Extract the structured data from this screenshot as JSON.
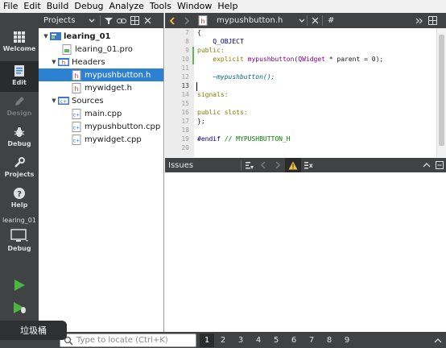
{
  "menu": [
    "File",
    "Edit",
    "Build",
    "Debug",
    "Analyze",
    "Tools",
    "Window",
    "Help"
  ],
  "modes": [
    {
      "label": "Welcome",
      "icon": "grid-icon"
    },
    {
      "label": "Edit",
      "icon": "document-icon"
    },
    {
      "label": "Design",
      "icon": "pencil-icon"
    },
    {
      "label": "Debug",
      "icon": "bug-icon"
    },
    {
      "label": "Projects",
      "icon": "wrench-icon"
    },
    {
      "label": "Help",
      "icon": "help-icon"
    }
  ],
  "kit": {
    "project": "learing_01",
    "mode": "Debug"
  },
  "projects_pane": {
    "title": "Projects",
    "tree": [
      {
        "label": "learing_01",
        "level": 0,
        "icon": "project-icon",
        "expanded": true
      },
      {
        "label": "learing_01.pro",
        "level": 1,
        "icon": "pro-file-icon"
      },
      {
        "label": "Headers",
        "level": 1,
        "icon": "folder-h-icon",
        "expanded": true
      },
      {
        "label": "mypushbutton.h",
        "level": 2,
        "icon": "header-file-icon",
        "selected": true
      },
      {
        "label": "mywidget.h",
        "level": 2,
        "icon": "header-file-icon"
      },
      {
        "label": "Sources",
        "level": 1,
        "icon": "folder-cpp-icon",
        "expanded": true
      },
      {
        "label": "main.cpp",
        "level": 2,
        "icon": "cpp-file-icon"
      },
      {
        "label": "mypushbutton.cpp",
        "level": 2,
        "icon": "cpp-file-icon"
      },
      {
        "label": "mywidget.cpp",
        "level": 2,
        "icon": "cpp-file-icon"
      }
    ]
  },
  "editor": {
    "file": "mypushbutton.h",
    "symbol": "#",
    "line_numbers": [
      "7",
      "8",
      "9",
      "10",
      "11",
      "12",
      "13",
      "14",
      "15",
      "16",
      "17",
      "18",
      "19",
      "20"
    ],
    "current_line": "13",
    "lines": [
      "{",
      "    Q_OBJECT",
      "public:",
      "    explicit mypushbutton(QWidget * parent = 0);",
      "",
      "    ~mypushbutton();",
      "",
      "signals:",
      "",
      "public slots:",
      "};",
      "",
      "#endif // MYPUSHBUTTON_H",
      ""
    ]
  },
  "issues": {
    "title": "Issues"
  },
  "status": {
    "locator_placeholder": "Type to locate (Ctrl+K)",
    "pane_numbers": [
      "1",
      "2",
      "3",
      "4",
      "5",
      "6",
      "7",
      "8",
      "9"
    ]
  },
  "tooltip": "垃圾桶",
  "colors": {
    "selection": "#2d81d3",
    "sidebar": "#404244",
    "run_green": "#4ab640"
  }
}
